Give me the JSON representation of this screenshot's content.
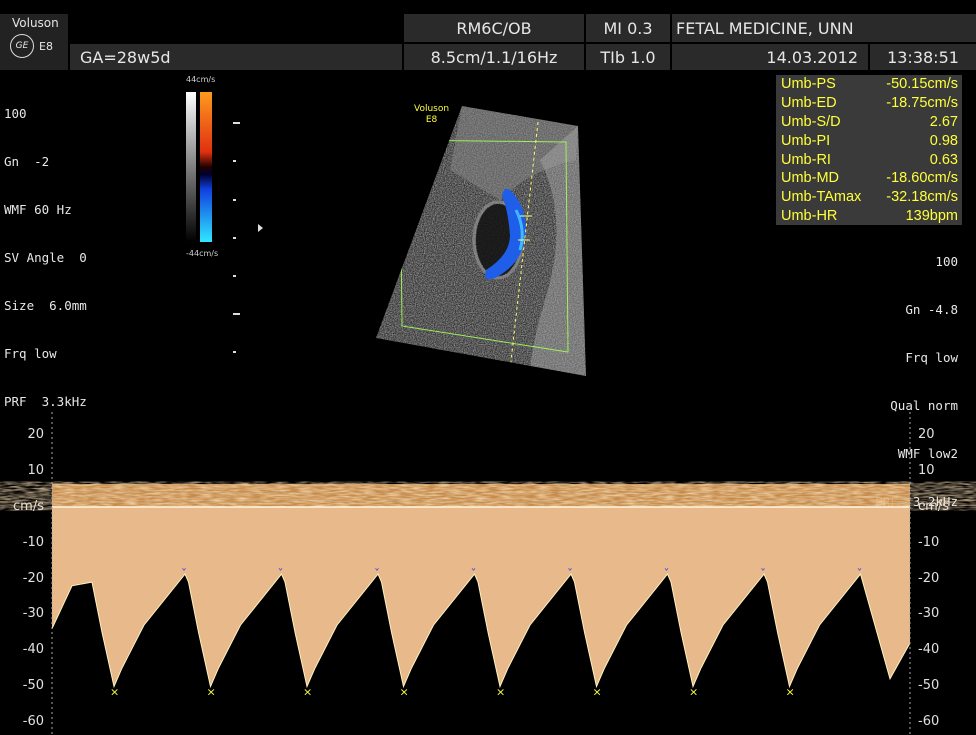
{
  "header": {
    "brand": "Voluson",
    "model": "E8",
    "logo": "GE",
    "ga": "GA=28w5d",
    "probe_preset": "RM6C/OB",
    "mi": "MI  0.3",
    "institution": "FETAL MEDICINE, UNN",
    "depth_freq": "8.5cm/1.1/16Hz",
    "tib": "TIb  1.0",
    "date": "14.03.2012",
    "time": "13:38:51"
  },
  "left_params": [
    "100",
    "Gn  -2",
    "WMF 60 Hz",
    "SV Angle  0",
    "Size  6.0mm",
    "Frq low",
    "PRF  3.3kHz"
  ],
  "colorbar": {
    "top_label": "44cm/s",
    "bottom_label": "-44cm/s"
  },
  "image_brand": {
    "line1": "Voluson",
    "line2": "E8"
  },
  "measurements": [
    {
      "name": "Umb-PS",
      "value": "-50.15cm/s"
    },
    {
      "name": "Umb-ED",
      "value": "-18.75cm/s"
    },
    {
      "name": "Umb-S/D",
      "value": "2.67"
    },
    {
      "name": "Umb-PI",
      "value": "0.98"
    },
    {
      "name": "Umb-RI",
      "value": "0.63"
    },
    {
      "name": "Umb-MD",
      "value": "-18.60cm/s"
    },
    {
      "name": "Umb-TAmax",
      "value": "-32.18cm/s"
    },
    {
      "name": "Umb-HR",
      "value": "139bpm"
    }
  ],
  "right_params": [
    "100",
    "Gn -4.8",
    "Frq low",
    "Qual norm",
    "WMF low2",
    "PRF  3.2kHz"
  ],
  "doppler_scale": {
    "unit": "cm/s",
    "ticks": [
      20,
      10,
      0,
      -10,
      -20,
      -30,
      -40,
      -50,
      -60
    ]
  },
  "waveform": {
    "systolic_peak": -50.15,
    "end_diastolic": -18.75,
    "cycles": 8
  },
  "colors": {
    "measure_text": "#ffff3a",
    "measure_bg": "#3a3a3a",
    "header_bg": "#2a2a2a",
    "spectrum": "#e8b98a"
  }
}
